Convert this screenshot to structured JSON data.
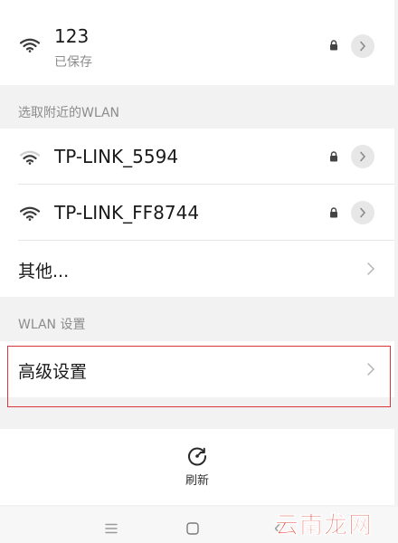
{
  "saved_network": {
    "ssid": "123",
    "status": "已保存"
  },
  "nearby_section": {
    "header": "选取附近的WLAN",
    "networks": [
      {
        "ssid": "TP-LINK_5594"
      },
      {
        "ssid": "TP-LINK_FF8744"
      }
    ],
    "other_label": "其他..."
  },
  "wlan_settings_section": {
    "header": "WLAN 设置",
    "advanced_label": "高级设置"
  },
  "bottom_action": {
    "refresh_label": "刷新",
    "icon": "refresh-icon"
  },
  "navigation_bar": {
    "icons": [
      "menu-icon",
      "home-icon",
      "back-icon"
    ]
  },
  "watermark": {
    "text": "云南龙网"
  },
  "colors": {
    "highlight_border": "#d9363e",
    "watermark": "#e0301e",
    "background": "#f2f2f2"
  }
}
